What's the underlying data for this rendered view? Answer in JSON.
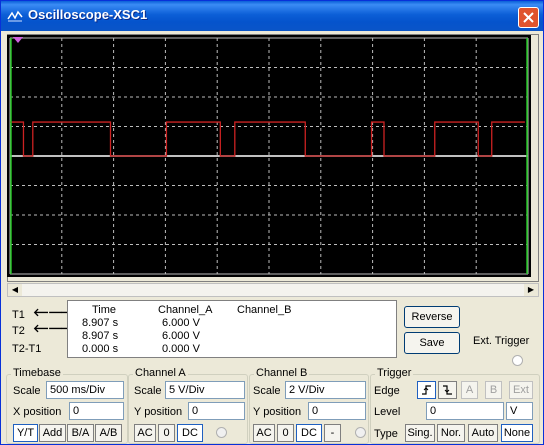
{
  "window": {
    "title": "Oscilloscope-XSC1"
  },
  "colors": {
    "screen": "#000000",
    "grid": "#bdbdbd",
    "channel_a": "#cc2222",
    "channel_b": "#ffffff",
    "cursor_t1": "#ff2020",
    "cursor_t2": "#2080ff",
    "titlebar": "#0a55c8"
  },
  "icons": {
    "app": "oscilloscope-icon",
    "close": "close-icon",
    "trigger_marker": "trigger-marker-icon"
  },
  "cursors": {
    "t1_label": "T1",
    "t2_label": "T2",
    "diff_label": "T2-T1",
    "headers": {
      "time": "Time",
      "channel_a": "Channel_A",
      "channel_b": "Channel_B"
    },
    "rows": [
      {
        "time": "8.907 s",
        "channel_a": "6.000 V",
        "channel_b": ""
      },
      {
        "time": "8.907 s",
        "channel_a": "6.000 V",
        "channel_b": ""
      },
      {
        "time": "0.000 s",
        "channel_a": "0.000 V",
        "channel_b": ""
      }
    ]
  },
  "buttons": {
    "reverse": "Reverse",
    "save": "Save",
    "ext_trigger": "Ext. Trigger"
  },
  "timebase": {
    "title": "Timebase",
    "scale_label": "Scale",
    "scale": "500 ms/Div",
    "xpos_label": "X position",
    "xpos": "0",
    "modes": [
      "Y/T",
      "Add",
      "B/A",
      "A/B"
    ],
    "active_mode": "Y/T"
  },
  "channel_a": {
    "title": "Channel A",
    "scale_label": "Scale",
    "scale": "5  V/Div",
    "ypos_label": "Y position",
    "ypos": "0",
    "coupling": [
      "AC",
      "0",
      "DC"
    ],
    "active_coupling": "DC"
  },
  "channel_b": {
    "title": "Channel B",
    "scale_label": "Scale",
    "scale": "2  V/Div",
    "ypos_label": "Y position",
    "ypos": "0",
    "coupling": [
      "AC",
      "0",
      "DC",
      "-"
    ],
    "active_coupling": "DC"
  },
  "trigger": {
    "title": "Trigger",
    "edge_label": "Edge",
    "level_label": "Level",
    "level": "0",
    "level_unit": "V",
    "type_label": "Type",
    "sources": [
      "A",
      "B",
      "Ext"
    ],
    "types": [
      "Sing.",
      "Nor.",
      "Auto",
      "None"
    ],
    "active_type": "None"
  },
  "chart_data": {
    "type": "line",
    "series": [
      {
        "name": "Channel_A",
        "color": "#cc2222",
        "x": [
          0,
          0.26,
          0.26,
          0.44,
          0.44,
          1.94,
          1.94,
          2.2,
          2.2,
          3.02,
          3.02,
          3.1,
          3.1,
          4.06,
          4.06,
          4.34,
          4.34,
          5.52,
          5.52,
          5.7,
          5.7,
          6.02,
          6.02,
          6.98,
          6.98,
          7.22,
          7.22,
          8.2,
          8.2,
          8.3,
          8.3,
          9.04,
          9.04,
          9.3,
          9.3,
          9.94
        ],
        "y": [
          5,
          5,
          0,
          0,
          5,
          5,
          0,
          0,
          0,
          0,
          5,
          5,
          5,
          5,
          0,
          0,
          5,
          5,
          5,
          5,
          0,
          0,
          0,
          0,
          5,
          5,
          0,
          0,
          5,
          5,
          5,
          5,
          0,
          0,
          5,
          5
        ]
      },
      {
        "name": "Channel_B",
        "color": "#ffffff",
        "x": [
          0,
          10
        ],
        "y": [
          0,
          0
        ]
      }
    ],
    "divisions": {
      "x": 10,
      "y": 8
    },
    "grid": true
  }
}
